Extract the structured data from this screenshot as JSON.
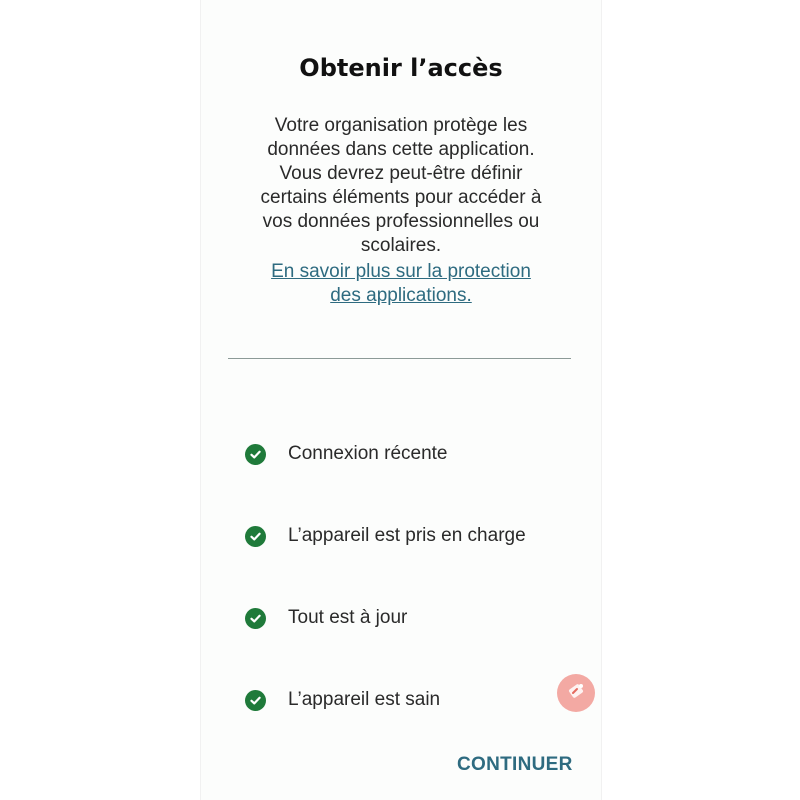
{
  "dialog": {
    "title": "Obtenir l’accès",
    "description_lines": [
      "Votre organisation protège les",
      "données dans cette application.",
      "Vous devrez peut-être définir",
      "certains éléments pour accéder à",
      "vos données professionnelles ou",
      "scolaires."
    ],
    "learn_more_lines": [
      "En savoir plus sur la protection",
      "des applications."
    ]
  },
  "checklist": [
    {
      "label": "Connexion récente",
      "status": "check-circle-icon"
    },
    {
      "label": "L’appareil est pris en charge",
      "status": "check-circle-icon"
    },
    {
      "label": "Tout est à jour",
      "status": "check-circle-icon"
    },
    {
      "label": "L’appareil est sain",
      "status": "check-circle-icon"
    }
  ],
  "actions": {
    "continue_label": "CONTINUER"
  },
  "floating_button": {
    "icon": "screen-record-icon"
  },
  "colors": {
    "accent": "#2e6b80",
    "success": "#1f7a3a",
    "fab": "#f3a9a3"
  }
}
